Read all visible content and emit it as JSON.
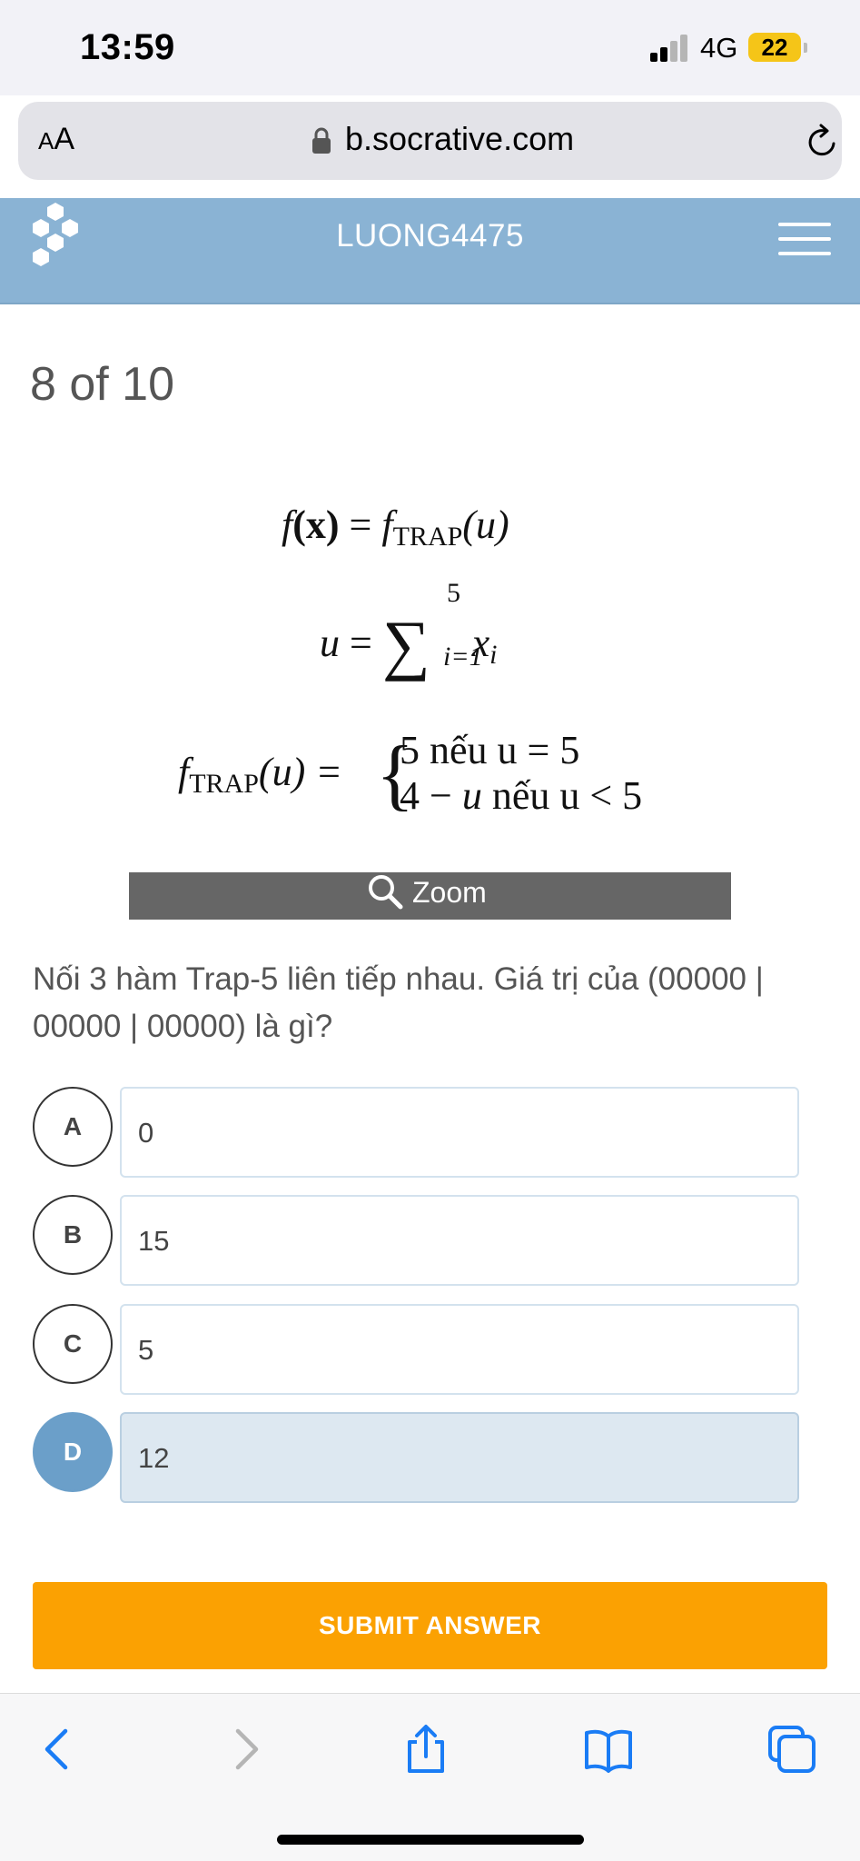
{
  "status_bar": {
    "time": "13:59",
    "network": "4G",
    "battery": "22"
  },
  "address_bar": {
    "aa_label_small": "A",
    "aa_label_large": "A",
    "url": "b.socrative.com"
  },
  "header": {
    "room_name": "LUONG4475"
  },
  "question": {
    "progress": "8 of 10",
    "formula": {
      "line1_f": "f",
      "line1_x": "(x)",
      "line1_eq": " = ",
      "line1_rhs_f": "f",
      "line1_sub": "TRAP",
      "line1_arg": "(u)",
      "line2_lhs": "u",
      "line2_eq": " = ",
      "sum_symbol": "∑",
      "sum_upper": "5",
      "sum_lower": "i=1",
      "sum_term": "x",
      "sum_term_sub": "i",
      "line3_f": "f",
      "line3_sub": "TRAP",
      "line3_arg": "(u) = ",
      "brace": "{",
      "case1": "5        nếu u = 5",
      "case2_a": "4 − ",
      "case2_u": "u",
      "case2_b": " nếu u < 5"
    },
    "zoom_label": "Zoom",
    "text": "Nối 3 hàm Trap-5 liên tiếp nhau. Giá trị của (00000 | 00000 | 00000) là gì?"
  },
  "options": [
    {
      "letter": "A",
      "text": "0",
      "selected": false
    },
    {
      "letter": "B",
      "text": "15",
      "selected": false
    },
    {
      "letter": "C",
      "text": "5",
      "selected": false
    },
    {
      "letter": "D",
      "text": "12",
      "selected": true
    }
  ],
  "submit_label": "SUBMIT ANSWER",
  "colors": {
    "header_bg": "#8ab3d4",
    "selected": "#6b9fc9",
    "submit": "#fba102",
    "ios_blue": "#1a7cf5"
  },
  "toolbar_icons": [
    "back-icon",
    "forward-icon",
    "share-icon",
    "bookmarks-icon",
    "tabs-icon"
  ]
}
